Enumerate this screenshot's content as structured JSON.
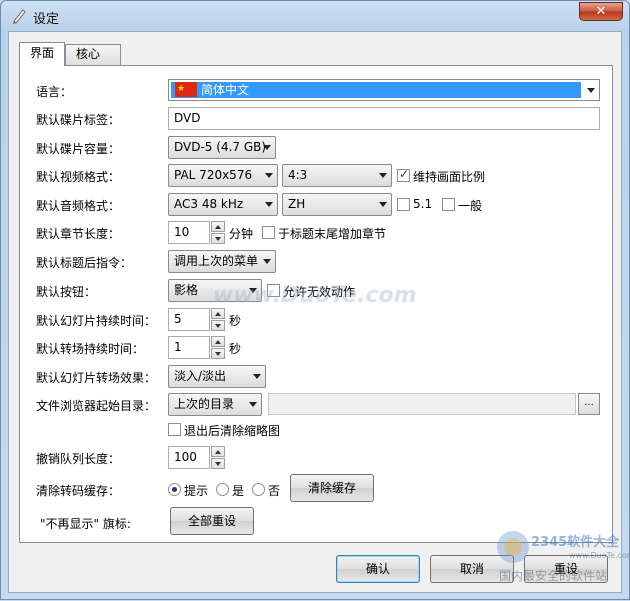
{
  "window": {
    "title": "设定",
    "close_label": "✕"
  },
  "tabs": [
    {
      "label": "界面"
    },
    {
      "label": "核心"
    }
  ],
  "form": {
    "language": {
      "label": "语言：",
      "value": "简体中文"
    },
    "disc_label": {
      "label": "默认碟片标签：",
      "value": "DVD"
    },
    "disc_capacity": {
      "label": "默认碟片容量：",
      "value": "DVD-5 (4.7 GB)"
    },
    "video_format": {
      "label": "默认视频格式：",
      "format": "PAL 720x576",
      "aspect": "4:3",
      "keep_ratio_label": "维持画面比例",
      "keep_ratio_checked": true
    },
    "audio_format": {
      "label": "默认音频格式：",
      "format": "AC3 48 kHz",
      "language": "ZH",
      "opt_51_label": "5.1",
      "opt_general_label": "一般"
    },
    "chapter_length": {
      "label": "默认章节长度：",
      "value": "10",
      "unit": "分钟",
      "add_chapter_label": "于标题末尾增加章节"
    },
    "post_title_cmd": {
      "label": "默认标题后指令：",
      "value": "调用上次的菜单"
    },
    "default_button": {
      "label": "默认按钮：",
      "value": "影格",
      "allow_invalid_label": "允许无效动作"
    },
    "slide_duration": {
      "label": "默认幻灯片持续时间：",
      "value": "5",
      "unit": "秒"
    },
    "transition_duration": {
      "label": "默认转场持续时间：",
      "value": "1",
      "unit": "秒"
    },
    "slide_effect": {
      "label": "默认幻灯片转场效果：",
      "value": "淡入/淡出"
    },
    "browser_start": {
      "label": "文件浏览器起始目录：",
      "value": "上次的目录",
      "browse_label": "...",
      "clear_thumbs_label": "退出后清除缩略图"
    },
    "undo_length": {
      "label": "撤销队列长度：",
      "value": "100"
    },
    "clear_cache": {
      "label": "清除转码缓存：",
      "opt_prompt": "提示",
      "opt_yes": "是",
      "opt_no": "否",
      "button": "清除缓存"
    },
    "dont_show": {
      "label": "\"不再显示\" 旗标:",
      "button": "全部重设"
    }
  },
  "footer": {
    "ok": "确认",
    "cancel": "取消",
    "reset": "重设"
  },
  "watermarks": {
    "duote": "www.DuoTe.com",
    "brand": "2345软件大全",
    "brand_url": "www.DuoTe.com",
    "brand_slogan": "国内最安全的软件站"
  }
}
